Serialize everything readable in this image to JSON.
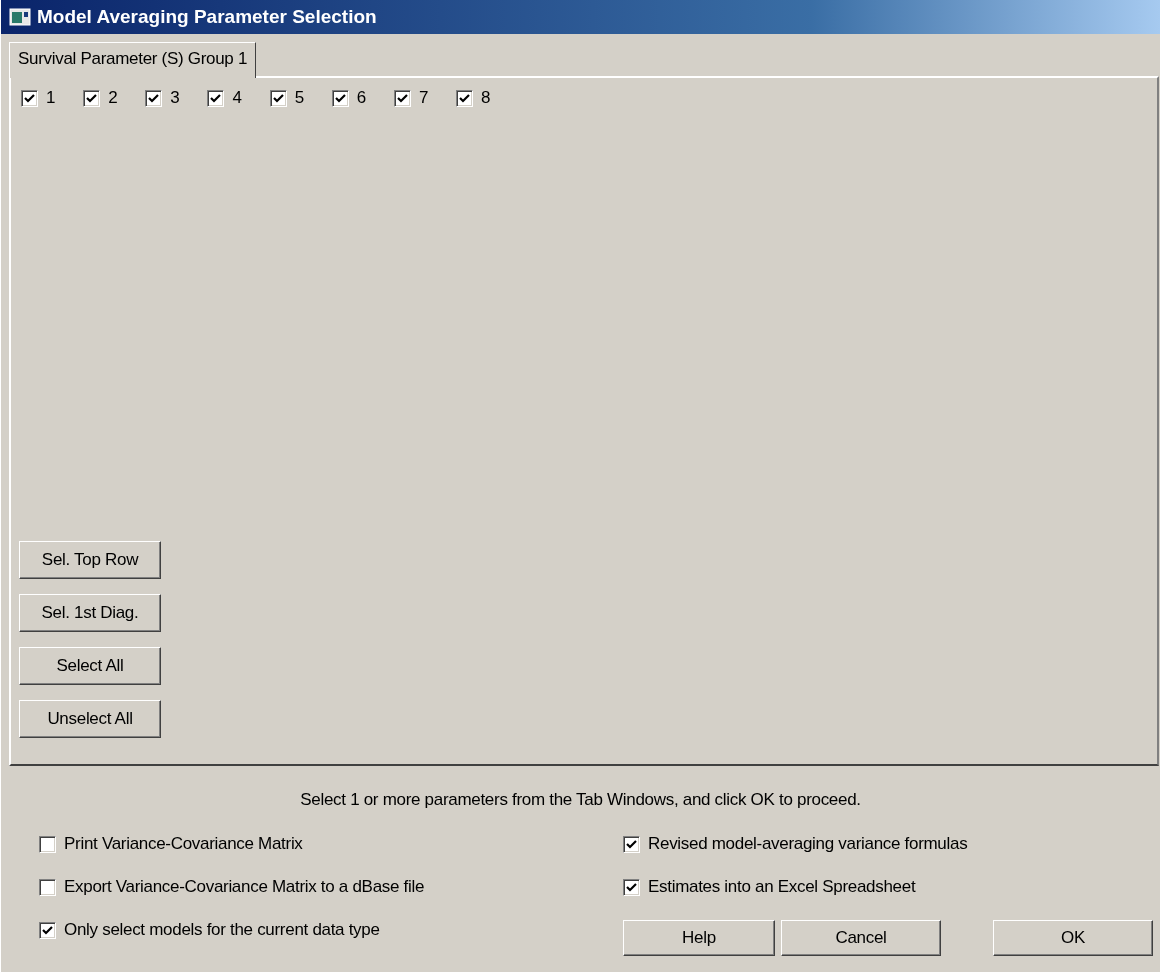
{
  "window": {
    "title": "Model Averaging Parameter Selection"
  },
  "tabs": [
    {
      "label": "Survival Parameter (S) Group 1",
      "selected": true
    }
  ],
  "parameters": [
    {
      "label": "1",
      "checked": true
    },
    {
      "label": "2",
      "checked": true
    },
    {
      "label": "3",
      "checked": true
    },
    {
      "label": "4",
      "checked": true
    },
    {
      "label": "5",
      "checked": true
    },
    {
      "label": "6",
      "checked": true
    },
    {
      "label": "7",
      "checked": true
    },
    {
      "label": "8",
      "checked": true
    }
  ],
  "selection_buttons": [
    "Sel. Top Row",
    "Sel. 1st Diag.",
    "Select All",
    "Unselect All"
  ],
  "instruction": "Select 1 or more parameters from the Tab Windows, and click OK to proceed.",
  "options_left": [
    {
      "label": "Print Variance-Covariance Matrix",
      "checked": false
    },
    {
      "label": "Export Variance-Covariance Matrix to a dBase file",
      "checked": false
    },
    {
      "label": "Only select models for the current data type",
      "checked": true
    }
  ],
  "options_right": [
    {
      "label": "Revised model-averaging variance formulas",
      "checked": true
    },
    {
      "label": "Estimates into an Excel Spreadsheet",
      "checked": true
    }
  ],
  "buttons": [
    "Help",
    "Cancel",
    "OK"
  ]
}
